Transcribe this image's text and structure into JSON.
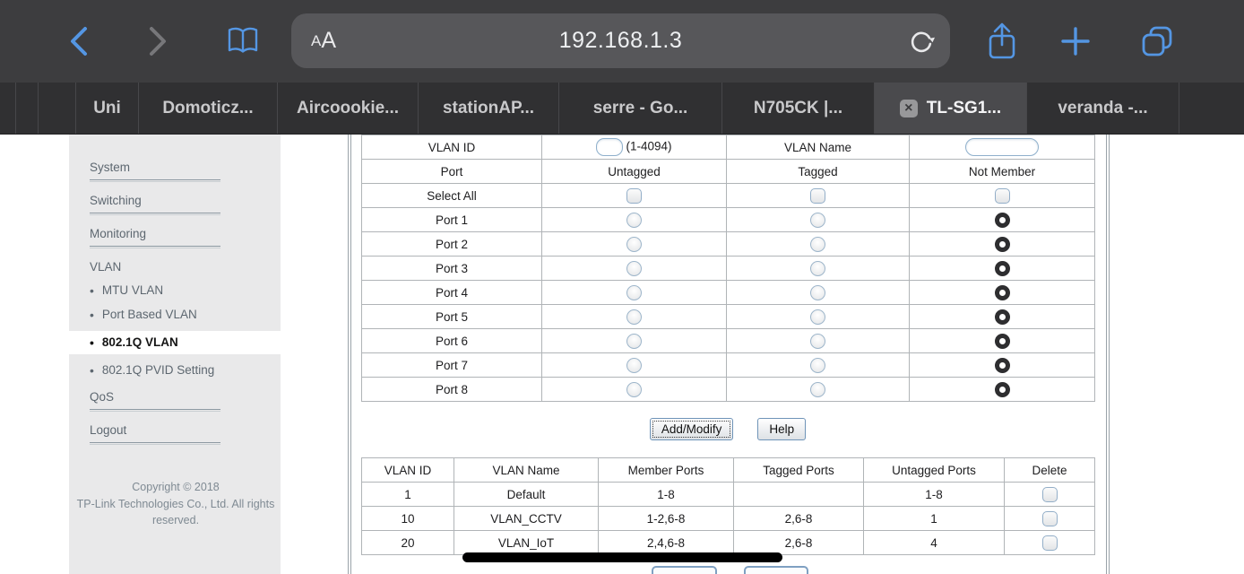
{
  "browser": {
    "aa": [
      "A",
      "A"
    ],
    "url": "192.168.1.3",
    "tabs": [
      {
        "label": "Uni",
        "active": false
      },
      {
        "label": "Domoticz...",
        "active": false
      },
      {
        "label": "Aircoookie...",
        "active": false
      },
      {
        "label": "stationAP...",
        "active": false
      },
      {
        "label": "serre - Go...",
        "active": false
      },
      {
        "label": "N705CK |...",
        "active": false
      },
      {
        "label": "TL-SG1...",
        "active": true
      },
      {
        "label": "veranda -...",
        "active": false
      }
    ],
    "close_glyph": "×"
  },
  "sidebar": {
    "items": [
      {
        "label": "System",
        "type": "section"
      },
      {
        "label": "Switching",
        "type": "section"
      },
      {
        "label": "Monitoring",
        "type": "section"
      },
      {
        "label": "VLAN",
        "type": "heading"
      },
      {
        "label": "MTU VLAN",
        "type": "sub",
        "selected": false
      },
      {
        "label": "Port Based VLAN",
        "type": "sub",
        "selected": false
      },
      {
        "label": "802.1Q VLAN",
        "type": "sub",
        "selected": true
      },
      {
        "label": "802.1Q PVID Setting",
        "type": "sub",
        "selected": false
      },
      {
        "label": "QoS",
        "type": "section"
      },
      {
        "label": "Logout",
        "type": "section"
      }
    ],
    "bullet": "•",
    "copyright_line1": "Copyright © 2018",
    "copyright_line2": "TP-Link Technologies Co., Ltd. All rights reserved."
  },
  "vlan_form": {
    "vlan_id_label": "VLAN ID",
    "vlan_id_value": "",
    "vlan_id_hint": "(1-4094)",
    "vlan_name_label": "VLAN Name",
    "vlan_name_value": "",
    "columns": [
      "Port",
      "Untagged",
      "Tagged",
      "Not Member"
    ],
    "select_all_label": "Select All",
    "ports": [
      {
        "label": "Port 1",
        "membership": "not_member"
      },
      {
        "label": "Port 2",
        "membership": "not_member"
      },
      {
        "label": "Port 3",
        "membership": "not_member"
      },
      {
        "label": "Port 4",
        "membership": "not_member"
      },
      {
        "label": "Port 5",
        "membership": "not_member"
      },
      {
        "label": "Port 6",
        "membership": "not_member"
      },
      {
        "label": "Port 7",
        "membership": "not_member"
      },
      {
        "label": "Port 8",
        "membership": "not_member"
      }
    ]
  },
  "buttons": {
    "add_modify": "Add/Modify",
    "help": "Help"
  },
  "vlan_table": {
    "columns": [
      "VLAN ID",
      "VLAN Name",
      "Member Ports",
      "Tagged Ports",
      "Untagged Ports",
      "Delete"
    ],
    "rows": [
      {
        "id": "1",
        "name": "Default",
        "member": "1-8",
        "tagged": "",
        "untagged": "1-8"
      },
      {
        "id": "10",
        "name": "VLAN_CCTV",
        "member": "1-2,6-8",
        "tagged": "2,6-8",
        "untagged": "1"
      },
      {
        "id": "20",
        "name": "VLAN_IoT",
        "member": "2,4,6-8",
        "tagged": "2,6-8",
        "untagged": "4"
      }
    ]
  }
}
